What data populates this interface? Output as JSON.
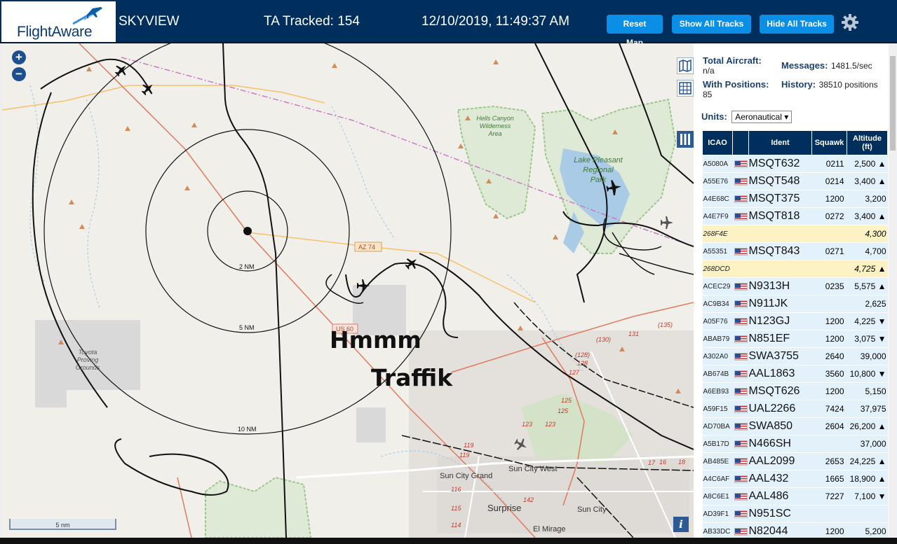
{
  "header": {
    "brand": "FlightAware",
    "app_title": "SKYVIEW",
    "tracked": "TA Tracked: 154",
    "clock": "12/10/2019, 11:49:37 AM",
    "reset_label": "Reset Map",
    "show_label": "Show All Tracks",
    "hide_label": "Hide All Tracks",
    "settings_icon": "gear-icon",
    "brand_color": "#002f5d",
    "button_color": "#0b8fe6"
  },
  "map": {
    "zoom_in": "+",
    "zoom_out": "−",
    "ring_labels": [
      "2 NM",
      "5 NM",
      "10 NM"
    ],
    "scale_label": "5 nm",
    "place_labels": {
      "hells_canyon": [
        "Hells Canyon",
        "Wilderness",
        "Area"
      ],
      "lake_pleasant": [
        "Lake Pleasant",
        "Regional",
        "Park"
      ],
      "toyota": [
        "Toyota",
        "Proving",
        "Grounds"
      ],
      "sun_city_grand": "Sun City Grand",
      "sun_city_west": "Sun City West",
      "surprise": "Surprise",
      "sun_city": "Sun City",
      "el_mirage": "El Mirage"
    },
    "road_labels": [
      "AZ 74",
      "US 60",
      "(130)",
      "131",
      "(135)",
      "(128)",
      "128",
      "127",
      "125",
      "125",
      "123",
      "123",
      "119",
      "119",
      "116",
      "115",
      "114",
      "142",
      "17",
      "16",
      "18"
    ],
    "annotation_1": "Hmmm",
    "annotation_2": "Traffik",
    "info_label": "i",
    "tool_icons": [
      "map-icon",
      "grid-icon",
      "columns-icon"
    ]
  },
  "panel": {
    "total_label": "Total Aircraft:",
    "total_value": "n/a",
    "messages_label": "Messages:",
    "messages_value": "1481.5/sec",
    "positions_label": "With Positions:",
    "positions_value": "85",
    "history_label": "History:",
    "history_value": "38510 positions",
    "units_label": "Units:",
    "units_value": "Aeronautical",
    "columns": [
      "ICAO",
      "",
      "Ident",
      "Squawk",
      "Altitude (ft)"
    ],
    "rows": [
      {
        "icao": "A5080A",
        "flag": true,
        "ident": "MSQT632",
        "squawk": "0211",
        "alt": "2,500 ▲",
        "sel": false
      },
      {
        "icao": "A55E76",
        "flag": true,
        "ident": "MSQT548",
        "squawk": "0214",
        "alt": "3,400 ▲",
        "sel": false
      },
      {
        "icao": "A4E68C",
        "flag": true,
        "ident": "MSQT375",
        "squawk": "1200",
        "alt": "3,200",
        "sel": false
      },
      {
        "icao": "A4E7F9",
        "flag": true,
        "ident": "MSQT818",
        "squawk": "0272",
        "alt": "3,400 ▲",
        "sel": false
      },
      {
        "icao": "268F4E",
        "flag": false,
        "ident": "",
        "squawk": "",
        "alt": "4,300",
        "sel": true
      },
      {
        "icao": "A55351",
        "flag": true,
        "ident": "MSQT843",
        "squawk": "0271",
        "alt": "4,700",
        "sel": false
      },
      {
        "icao": "268DCD",
        "flag": false,
        "ident": "",
        "squawk": "",
        "alt": "4,725 ▲",
        "sel": true
      },
      {
        "icao": "ACEC29",
        "flag": true,
        "ident": "N9313H",
        "squawk": "0235",
        "alt": "5,575 ▲",
        "sel": false
      },
      {
        "icao": "AC9B34",
        "flag": true,
        "ident": "N911JK",
        "squawk": "",
        "alt": "2,625",
        "sel": false
      },
      {
        "icao": "A05F76",
        "flag": true,
        "ident": "N123GJ",
        "squawk": "1200",
        "alt": "4,225 ▼",
        "sel": false
      },
      {
        "icao": "ABAB79",
        "flag": true,
        "ident": "N851EF",
        "squawk": "1200",
        "alt": "3,075 ▼",
        "sel": false
      },
      {
        "icao": "A302A0",
        "flag": true,
        "ident": "SWA3755",
        "squawk": "2640",
        "alt": "39,000",
        "sel": false
      },
      {
        "icao": "AB674B",
        "flag": true,
        "ident": "AAL1863",
        "squawk": "3560",
        "alt": "10,800 ▼",
        "sel": false
      },
      {
        "icao": "A6EB93",
        "flag": true,
        "ident": "MSQT626",
        "squawk": "1200",
        "alt": "5,150",
        "sel": false
      },
      {
        "icao": "A59F15",
        "flag": true,
        "ident": "UAL2266",
        "squawk": "7424",
        "alt": "37,975",
        "sel": false
      },
      {
        "icao": "AD70BA",
        "flag": true,
        "ident": "SWA850",
        "squawk": "2604",
        "alt": "26,200 ▲",
        "sel": false
      },
      {
        "icao": "A5B17D",
        "flag": true,
        "ident": "N466SH",
        "squawk": "",
        "alt": "37,000",
        "sel": false
      },
      {
        "icao": "AB485E",
        "flag": true,
        "ident": "AAL2099",
        "squawk": "2653",
        "alt": "24,225 ▲",
        "sel": false
      },
      {
        "icao": "A4C6AF",
        "flag": true,
        "ident": "AAL432",
        "squawk": "1665",
        "alt": "18,900 ▲",
        "sel": false
      },
      {
        "icao": "A8C6E1",
        "flag": true,
        "ident": "AAL486",
        "squawk": "7227",
        "alt": "7,100 ▼",
        "sel": false
      },
      {
        "icao": "AD39F1",
        "flag": true,
        "ident": "N951SC",
        "squawk": "",
        "alt": "",
        "sel": false
      },
      {
        "icao": "AB33DC",
        "flag": true,
        "ident": "N82044",
        "squawk": "1200",
        "alt": "5,200",
        "sel": false
      }
    ]
  }
}
